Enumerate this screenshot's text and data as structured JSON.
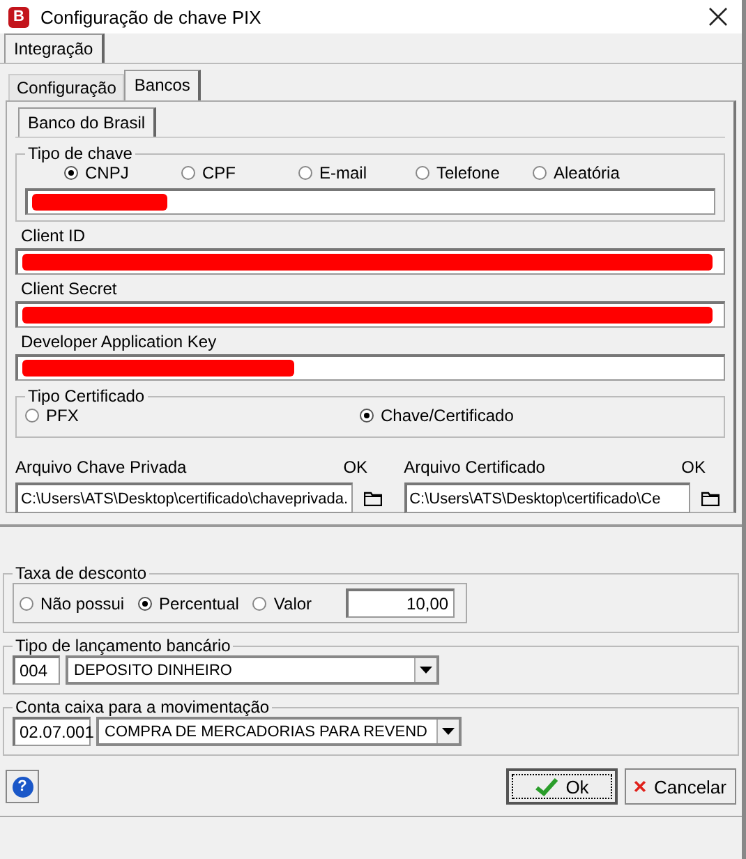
{
  "window": {
    "title": "Configuração de chave PIX",
    "app_badge": "B"
  },
  "outer_tabs": [
    {
      "label": "Integração",
      "selected": true
    }
  ],
  "tabs": [
    {
      "label": "Configuração",
      "selected": false
    },
    {
      "label": "Bancos",
      "selected": true
    }
  ],
  "bank_tabs": [
    {
      "label": "Banco do Brasil",
      "selected": true
    }
  ],
  "tipo_de_chave": {
    "title": "Tipo de chave",
    "options": [
      {
        "label": "CNPJ",
        "selected": true
      },
      {
        "label": "CPF",
        "selected": false
      },
      {
        "label": "E-mail",
        "selected": false
      },
      {
        "label": "Telefone",
        "selected": false
      },
      {
        "label": "Aleatória",
        "selected": false
      }
    ]
  },
  "fields": [
    {
      "label": "Client ID"
    },
    {
      "label": "Client Secret"
    },
    {
      "label": "Developer Application Key"
    }
  ],
  "tipo_certificado": {
    "title": "Tipo Certificado",
    "options": [
      {
        "label": "PFX",
        "selected": false
      },
      {
        "label": "Chave/Certificado",
        "selected": true
      }
    ]
  },
  "files": [
    {
      "label": "Arquivo Chave Privada",
      "status": "OK",
      "value": "C:\\Users\\ATS\\Desktop\\certificado\\chaveprivada."
    },
    {
      "label": "Arquivo Certificado",
      "status": "OK",
      "value": "C:\\Users\\ATS\\Desktop\\certificado\\Ce"
    }
  ],
  "taxa": {
    "title": "Taxa de desconto",
    "options": [
      {
        "label": "Não possui",
        "selected": false
      },
      {
        "label": "Percentual",
        "selected": true
      },
      {
        "label": "Valor",
        "selected": false
      }
    ],
    "value": "10,00"
  },
  "lancamento": {
    "title": "Tipo de lançamento bancário",
    "code": "004",
    "value": "DEPOSITO DINHEIRO"
  },
  "conta": {
    "title": "Conta caixa para a movimentação",
    "code": "02.07.001",
    "value": "COMPRA DE MERCADORIAS PARA REVEND"
  },
  "help_button": "?",
  "buttons": [
    {
      "kind": "ok",
      "label": "Ok"
    },
    {
      "kind": "cancel",
      "label": "Cancelar"
    }
  ]
}
